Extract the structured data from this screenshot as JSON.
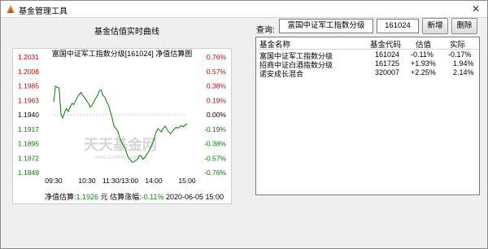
{
  "window": {
    "title": "基金管理工具"
  },
  "chart_panel": {
    "heading": "基金估值实时曲线",
    "subtitle": "富国中证军工指数分级[161024] 净值估算图",
    "footer": {
      "nav_label": "净值估算:",
      "nav_value": "1.1926",
      "nav_unit": "元",
      "change_label": "估算涨幅:",
      "change_value": "-0.11%",
      "timestamp": "2020-06-05 15:00"
    }
  },
  "query": {
    "label": "查询:",
    "fund_name_value": "富国中证军工指数分级",
    "fund_code_value": "161024",
    "add_label": "新增",
    "delete_label": "删除"
  },
  "fund_list": {
    "columns": [
      "基金名称",
      "基金代码",
      "估值",
      "实际"
    ],
    "rows": [
      [
        "富国中证军工指数分级",
        "161024",
        "-0.11%",
        "-0.17%"
      ],
      [
        "招商中证白酒指数分级",
        "161725",
        "+1.93%",
        "1.94%"
      ],
      [
        "诺安成长混合",
        "320007",
        "+2.25%",
        "2.14%"
      ]
    ]
  },
  "chart_data": {
    "type": "line",
    "title": "富国中证军工指数分级[161024] 净值估算图",
    "xlabel": "",
    "ylabel": "",
    "x_ticks": [
      "09:30",
      "10:30",
      "11:30/13:00",
      "14:00",
      "15:00"
    ],
    "y_ticks_left": [
      "1.2031",
      "1.2008",
      "1.1985",
      "1.1963",
      "1.1940",
      "1.1917",
      "1.1895",
      "1.1872",
      "1.1849"
    ],
    "y_ticks_right": [
      "0.76%",
      "0.57%",
      "0.38%",
      "0.19%",
      "0.00%",
      "-0.19%",
      "-0.38%",
      "-0.57%",
      "-0.76%"
    ],
    "ylim": [
      1.1849,
      1.2031
    ],
    "series": [
      {
        "name": "",
        "color": "#008000",
        "values": [
          1.196,
          1.1985,
          1.1983,
          1.1982,
          1.194,
          1.1935,
          1.1944,
          1.195,
          1.1945,
          1.1952,
          1.1958,
          1.1956,
          1.1962,
          1.1968,
          1.1972,
          1.1975,
          1.197,
          1.1967,
          1.1962,
          1.1958,
          1.1952,
          1.1955,
          1.196,
          1.1966,
          1.197,
          1.1978,
          1.1979,
          1.197,
          1.1968,
          1.196,
          1.1955,
          1.1945,
          1.1935,
          1.1922,
          1.1918,
          1.1915,
          1.1905,
          1.1898,
          1.1892,
          1.1888,
          1.1879,
          1.1872,
          1.1869,
          1.1865,
          1.1866,
          1.1868,
          1.187,
          1.1876,
          1.1874,
          1.187,
          1.1873,
          1.1878,
          1.1882,
          1.1888,
          1.1894,
          1.1902,
          1.1912,
          1.1918,
          1.1916,
          1.1913,
          1.1919,
          1.1922,
          1.1917,
          1.1913,
          1.191,
          1.1914,
          1.1918,
          1.192,
          1.1919,
          1.1921,
          1.1923,
          1.1921,
          1.1924,
          1.1926
        ]
      }
    ],
    "grid": false,
    "baseline": 1.194
  },
  "watermark": {
    "text": "天天基金网",
    "url": "www.1234567.com.cn"
  },
  "colors": {
    "positive": "#d40000",
    "negative": "#008000",
    "series": "#008000"
  }
}
